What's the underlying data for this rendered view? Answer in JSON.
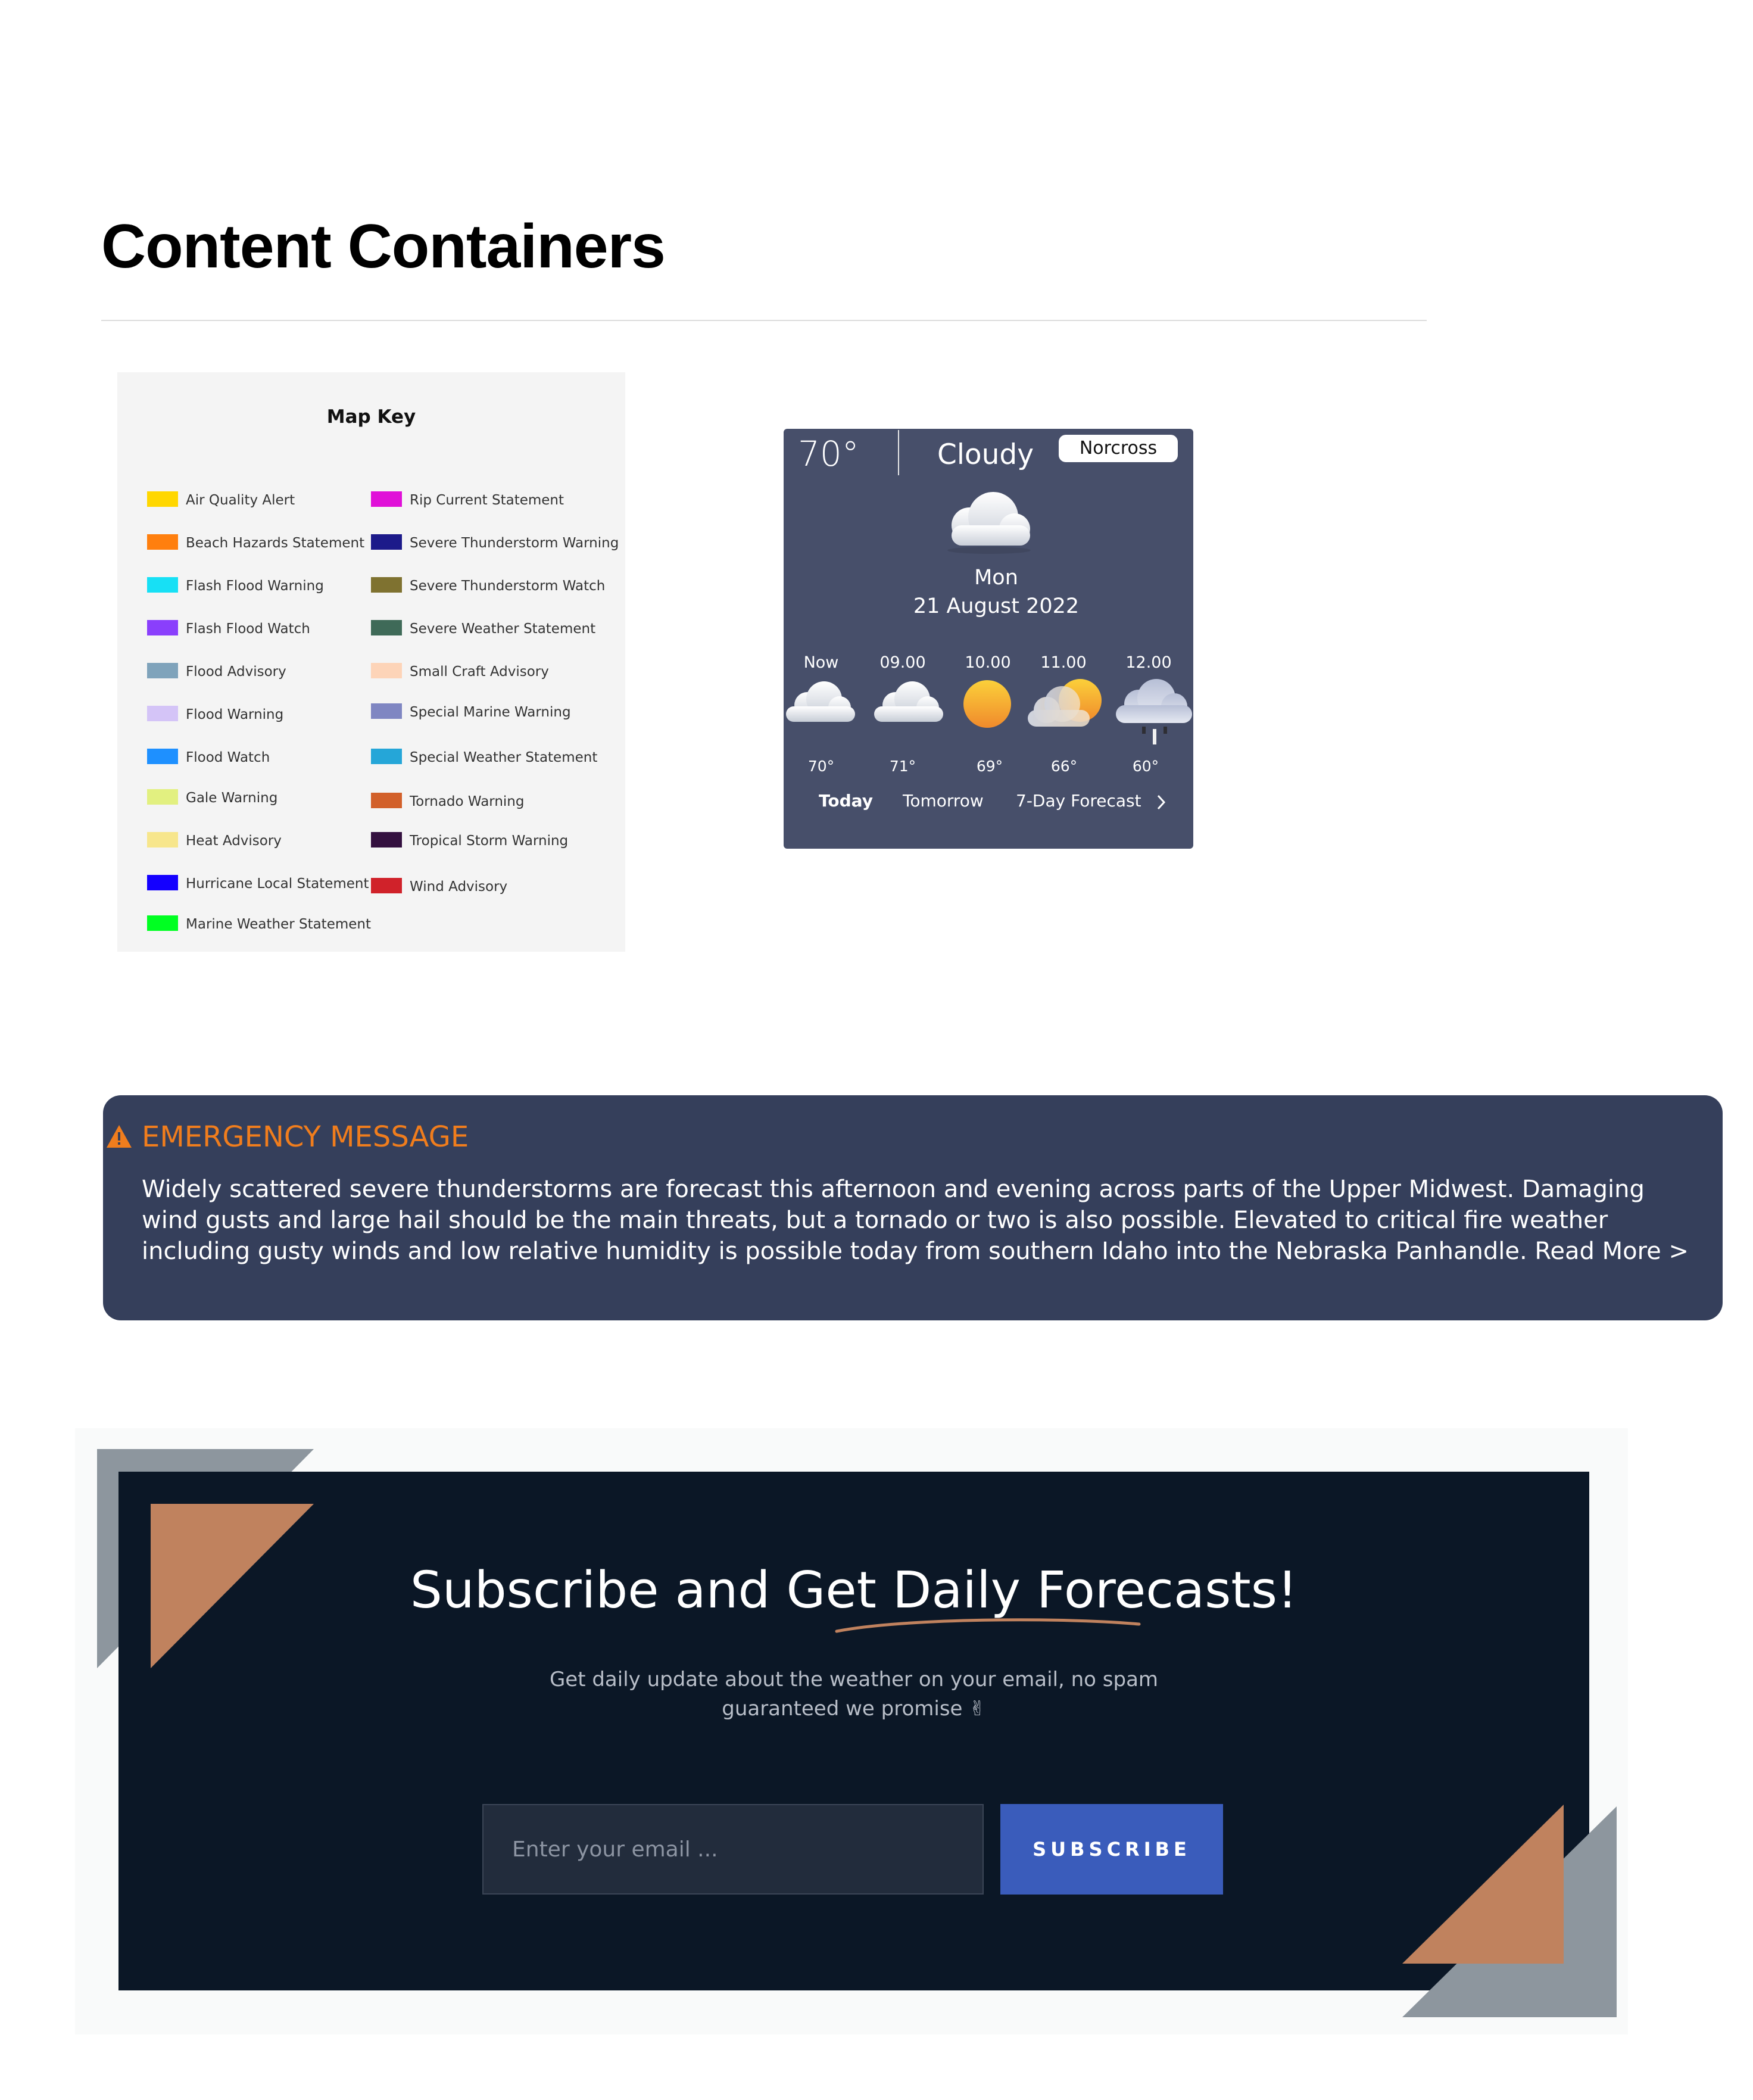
{
  "page": {
    "title": "Content Containers"
  },
  "map_key": {
    "title": "Map Key",
    "left_items": [
      {
        "label": "Air Quality Alert",
        "color": "#ffd700"
      },
      {
        "label": "Beach Hazards Statement",
        "color": "#ff7f0e"
      },
      {
        "label": "Flash Flood Warning",
        "color": "#17e0f5"
      },
      {
        "label": "Flash Flood Watch",
        "color": "#8a3ffc"
      },
      {
        "label": "Flood Advisory",
        "color": "#7fa3bb"
      },
      {
        "label": "Flood Warning",
        "color": "#d4c4f7"
      },
      {
        "label": "Flood Watch",
        "color": "#1e90ff"
      },
      {
        "label": "Gale Warning",
        "color": "#e2f080"
      },
      {
        "label": "Heat Advisory",
        "color": "#f7e68c"
      },
      {
        "label": "Hurricane Local Statement",
        "color": "#1400ff"
      },
      {
        "label": "Marine Weather Statement",
        "color": "#00ff22"
      }
    ],
    "right_items": [
      {
        "label": "Rip Current Statement",
        "color": "#e010d8"
      },
      {
        "label": "Severe Thunderstorm Warning",
        "color": "#1c1a8a"
      },
      {
        "label": "Severe Thunderstorm Watch",
        "color": "#7f7230"
      },
      {
        "label": "Severe Weather Statement",
        "color": "#3f6a58"
      },
      {
        "label": "Small Craft Advisory",
        "color": "#fdd4b8"
      },
      {
        "label": "Special Marine Warning",
        "color": "#7f86c2"
      },
      {
        "label": "Special Weather Statement",
        "color": "#25a6d8"
      },
      {
        "label": "Tornado Warning",
        "color": "#d2602a"
      },
      {
        "label": "Tropical Storm Warning",
        "color": "#33103f"
      },
      {
        "label": "Wind Advisory",
        "color": "#d0222a"
      }
    ]
  },
  "weather": {
    "temp": "70°",
    "condition": "Cloudy",
    "location": "Norcross",
    "main_icon": "cloud-icon",
    "day": "Mon",
    "date": "21 August 2022",
    "hourly": [
      {
        "time": "Now",
        "icon": "cloud-icon",
        "temp": "70°"
      },
      {
        "time": "09.00",
        "icon": "cloud-icon",
        "temp": "71°"
      },
      {
        "time": "10.00",
        "icon": "sun-icon",
        "temp": "69°"
      },
      {
        "time": "11.00",
        "icon": "partly-cloudy-icon",
        "temp": "66°"
      },
      {
        "time": "12.00",
        "icon": "rain-cloud-icon",
        "temp": "60°"
      }
    ],
    "tabs": {
      "today": "Today",
      "tomorrow": "Tomorrow",
      "seven_day": "7-Day Forecast"
    },
    "colors": {
      "card": "#474f6a"
    }
  },
  "emergency": {
    "title": "EMERGENCY MESSAGE",
    "icon": "warning-icon",
    "body": "Widely scattered severe thunderstorms are forecast this afternoon and evening across parts of the Upper Midwest. Damaging wind gusts and large hail should be the main threats, but a tornado or two is also possible. Elevated to critical fire weather including gusty winds and low relative humidity is possible today from southern Idaho into the Nebraska Panhandle.",
    "read_more": "Read More >",
    "colors": {
      "background": "#353f5b",
      "title": "#f07d1d"
    }
  },
  "subscribe": {
    "title": "Subscribe and Get Daily Forecasts!",
    "text": "Get daily update about the weather on your email, no spam guaranteed we promise ✌",
    "email_placeholder": "Enter your email ...",
    "button_label": "SUBSCRIBE",
    "colors": {
      "background": "#0b1726",
      "button": "#3a5cbb",
      "accent": "#c0825e",
      "gray": "#8d969e"
    }
  }
}
